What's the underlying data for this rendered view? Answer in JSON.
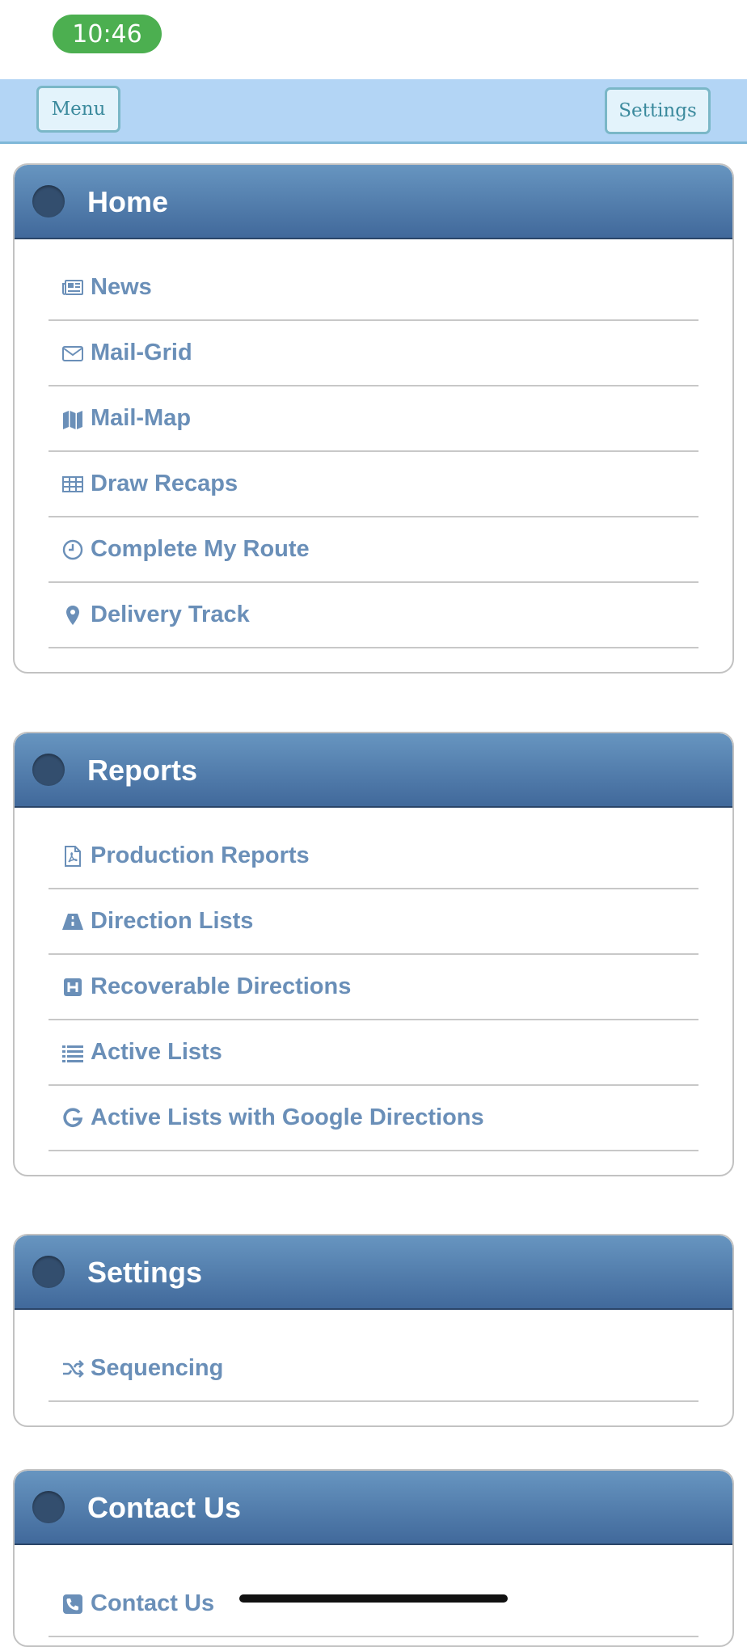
{
  "status_bar": {
    "time": "10:46"
  },
  "top_bar": {
    "menu_label": "Menu",
    "settings_label": "Settings"
  },
  "sections": [
    {
      "title": "Home",
      "items": [
        {
          "label": "News",
          "icon": "newspaper-icon"
        },
        {
          "label": "Mail-Grid",
          "icon": "envelope-icon"
        },
        {
          "label": "Mail-Map",
          "icon": "map-icon"
        },
        {
          "label": "Draw Recaps",
          "icon": "table-icon"
        },
        {
          "label": "Complete My Route",
          "icon": "clock-icon"
        },
        {
          "label": "Delivery Track",
          "icon": "map-marker-icon"
        }
      ]
    },
    {
      "title": "Reports",
      "items": [
        {
          "label": "Production Reports",
          "icon": "pdf-file-icon"
        },
        {
          "label": "Direction Lists",
          "icon": "road-icon"
        },
        {
          "label": "Recoverable Directions",
          "icon": "hospital-icon"
        },
        {
          "label": "Active Lists",
          "icon": "list-icon"
        },
        {
          "label": "Active Lists with Google Directions",
          "icon": "google-icon"
        }
      ]
    },
    {
      "title": "Settings",
      "items": [
        {
          "label": "Sequencing",
          "icon": "random-icon"
        }
      ]
    },
    {
      "title": "Contact Us",
      "items": [
        {
          "label": "Contact Us",
          "icon": "phone-square-icon"
        }
      ]
    }
  ],
  "colors": {
    "header_top": "#6795c0",
    "header_bottom": "#41699b",
    "link_text": "#6a8fb8",
    "top_bar": "#b3d5f5",
    "time_pill": "#4caf50"
  }
}
